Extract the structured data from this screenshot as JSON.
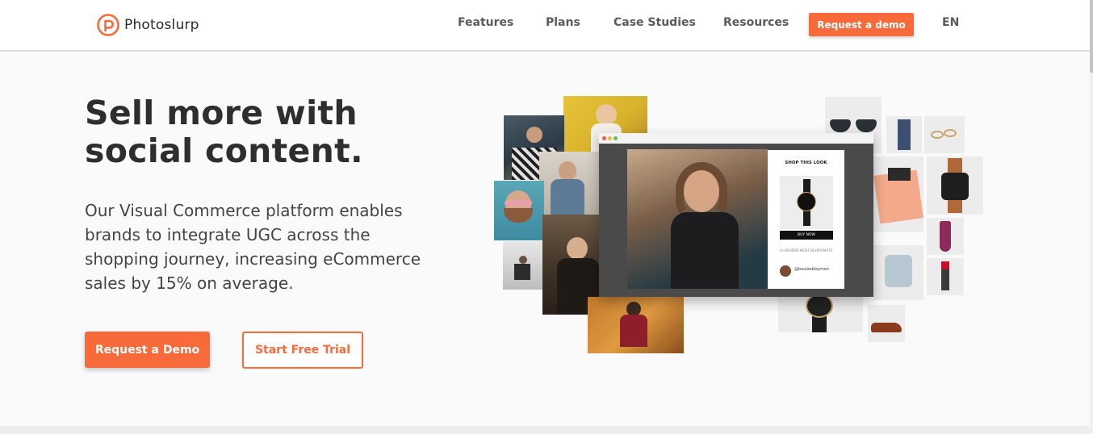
{
  "brand": {
    "name": "Photoslurp",
    "accent": "#f86a3a",
    "icon": "photoslurp-logo-icon"
  },
  "nav": {
    "items": [
      "Features",
      "Plans",
      "Case Studies",
      "Resources"
    ],
    "cta_label": "Request a demo",
    "language": "EN"
  },
  "hero": {
    "headline": "Sell more with social content.",
    "subtext": "Our Visual Commerce platform enables brands to integrate UGC across the shopping journey, increasing eCommerce sales by 15% on average.",
    "primary_button": "Request a Demo",
    "secondary_button": "Start Free Trial"
  },
  "collage": {
    "card_title": "SHOP THIS LOOK",
    "buy_label": "BUY NOW",
    "product_name": "LA BOHÈME MESH SILVER/WHITE",
    "handle": "@boulasblaymen"
  }
}
